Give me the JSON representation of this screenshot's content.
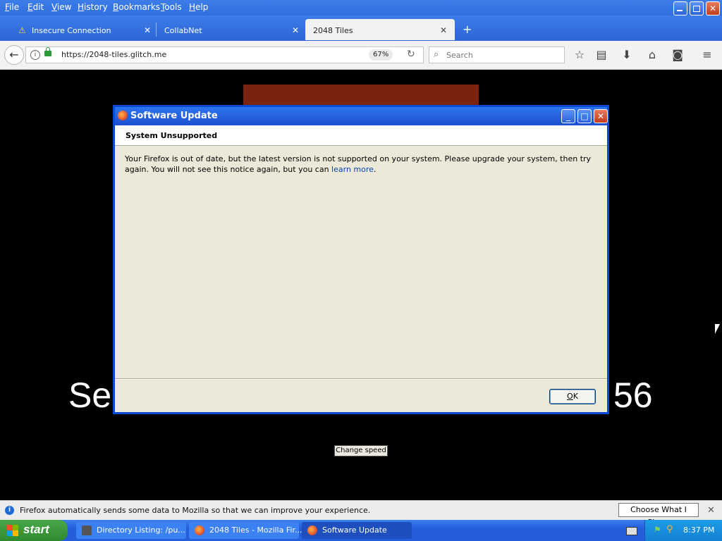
{
  "menubar": {
    "items": [
      {
        "label": "File",
        "u": "F",
        "rest": "ile"
      },
      {
        "label": "Edit",
        "u": "E",
        "rest": "dit"
      },
      {
        "label": "View",
        "u": "V",
        "rest": "iew"
      },
      {
        "label": "History",
        "u": "H",
        "rest": "istory"
      },
      {
        "label": "Bookmarks",
        "u": "B",
        "rest": "ookmarks"
      },
      {
        "label": "Tools",
        "u": "T",
        "rest": "ools"
      },
      {
        "label": "Help",
        "u": "H",
        "rest": "elp"
      }
    ]
  },
  "tabs": [
    {
      "label": "Insecure Connection",
      "icon": "warning-icon"
    },
    {
      "label": "CollabNet"
    },
    {
      "label": "2048 Tiles",
      "active": true
    }
  ],
  "navbar": {
    "url": "https://2048-tiles.glitch.me",
    "zoom": "67%",
    "search_placeholder": "Search"
  },
  "page": {
    "big_left": "Se",
    "big_right": "56",
    "change_speed": "Change speed",
    "accent_color": "#7a2410"
  },
  "dialog": {
    "title": "Software Update",
    "header": "System Unsupported",
    "body": "Your Firefox is out of date, but the latest version is not supported on your system. Please upgrade your system, then try again. You will not see this notice again, but you can ",
    "link": "learn more",
    "body_end": ".",
    "ok_underline": "O",
    "ok_rest": "K"
  },
  "notification": {
    "message": "Firefox automatically sends some data to Mozilla so that we can improve your experience.",
    "button": "Choose What I Share"
  },
  "taskbar": {
    "start": "start",
    "tasks": [
      {
        "label": "Directory Listing: /pu..."
      },
      {
        "label": "2048 Tiles - Mozilla Fir..."
      },
      {
        "label": "Software Update",
        "active": true
      }
    ],
    "clock": "8:37 PM"
  }
}
